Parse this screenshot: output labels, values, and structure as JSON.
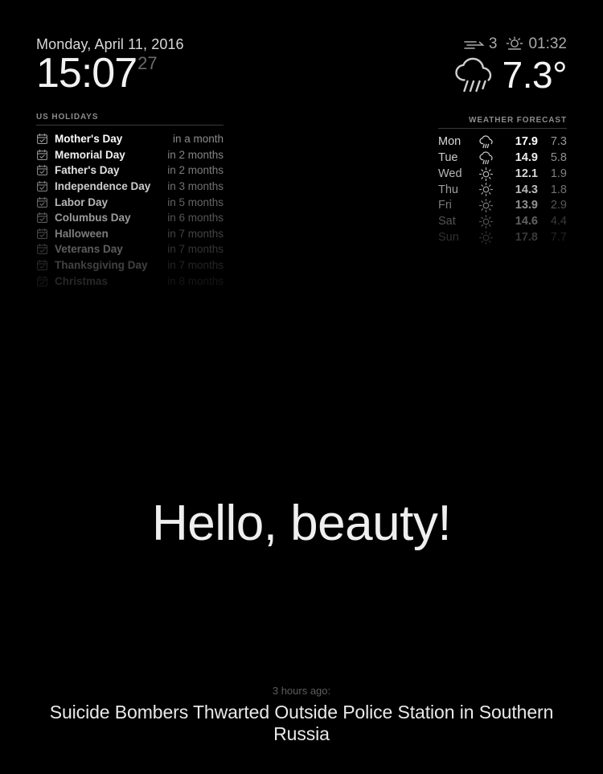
{
  "clock": {
    "date": "Monday, April 11, 2016",
    "time": "15:07",
    "seconds": "27"
  },
  "holidays": {
    "section_label": "US Holidays",
    "icon": "calendar-check-icon",
    "items": [
      {
        "name": "Mother's Day",
        "when": "in a month",
        "opacity": 1.0
      },
      {
        "name": "Memorial Day",
        "when": "in 2 months",
        "opacity": 0.94
      },
      {
        "name": "Father's Day",
        "when": "in 2 months",
        "opacity": 0.88
      },
      {
        "name": "Independence Day",
        "when": "in 3 months",
        "opacity": 0.8
      },
      {
        "name": "Labor Day",
        "when": "in 5 months",
        "opacity": 0.71
      },
      {
        "name": "Columbus Day",
        "when": "in 6 months",
        "opacity": 0.6
      },
      {
        "name": "Halloween",
        "when": "in 7 months",
        "opacity": 0.48
      },
      {
        "name": "Veterans Day",
        "when": "in 7 months",
        "opacity": 0.36
      },
      {
        "name": "Thanksgiving Day",
        "when": "in 7 months",
        "opacity": 0.25
      },
      {
        "name": "Christmas",
        "when": "in 8 months",
        "opacity": 0.15
      }
    ]
  },
  "weather_now": {
    "wind_icon": "wind-icon",
    "wind_speed": "3",
    "sunset_icon": "sunset-sun-icon",
    "sunset_time": "01:32",
    "condition_icon": "rain-cloud-icon",
    "temperature": "7.3°"
  },
  "forecast": {
    "section_label": "Weather Forecast",
    "rows": [
      {
        "day": "Mon",
        "icon": "rain-cloud-icon",
        "high": "17.9",
        "low": "7.3",
        "opacity": 1.0
      },
      {
        "day": "Tue",
        "icon": "rain-cloud-icon",
        "high": "14.9",
        "low": "5.8",
        "opacity": 0.93
      },
      {
        "day": "Wed",
        "icon": "sun-icon",
        "high": "12.1",
        "low": "1.9",
        "opacity": 0.84
      },
      {
        "day": "Thu",
        "icon": "sun-icon",
        "high": "14.3",
        "low": "1.8",
        "opacity": 0.72
      },
      {
        "day": "Fri",
        "icon": "sun-icon",
        "high": "13.9",
        "low": "2.9",
        "opacity": 0.56
      },
      {
        "day": "Sat",
        "icon": "sun-icon",
        "high": "14.6",
        "low": "4.4",
        "opacity": 0.38
      },
      {
        "day": "Sun",
        "icon": "sun-icon",
        "high": "17.8",
        "low": "7.7",
        "opacity": 0.22
      }
    ]
  },
  "greeting": {
    "text": "Hello, beauty!"
  },
  "news": {
    "time_ago": "3 hours ago:",
    "headline": "Suicide Bombers Thwarted Outside Police Station in Southern Russia"
  },
  "colors": {
    "background": "#000000",
    "primary_text": "#ffffff",
    "muted_text": "#8d8d8d",
    "rule": "#3a3a3a"
  }
}
